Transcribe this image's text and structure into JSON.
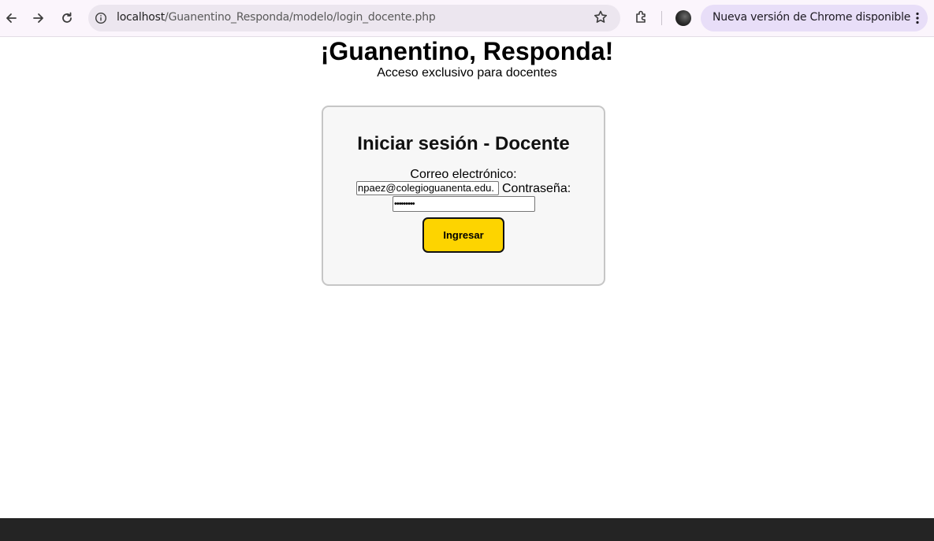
{
  "browser": {
    "url_host": "localhost",
    "url_path": "/Guanentino_Responda/modelo/login_docente.php",
    "update_label": "Nueva versión de Chrome disponible",
    "icons": [
      "back-arrow-icon",
      "forward-arrow-icon",
      "reload-icon",
      "site-info-icon",
      "bookmark-star-icon",
      "extensions-icon",
      "profile-avatar",
      "more-vertical-icon"
    ]
  },
  "page": {
    "title": "¡Guanentino, Responda!",
    "subtitle": "Acceso exclusivo para docentes"
  },
  "login": {
    "heading": "Iniciar sesión - Docente",
    "email_label": "Correo electrónico:",
    "email_value": "npaez@colegioguanenta.edu.",
    "password_label": "Contraseña:",
    "password_mask": "•••••••••",
    "submit_label": "Ingresar"
  },
  "colors": {
    "button_bg": "#fdd400",
    "card_bg": "#f7f7f7",
    "update_chip_bg": "#e8def8"
  }
}
